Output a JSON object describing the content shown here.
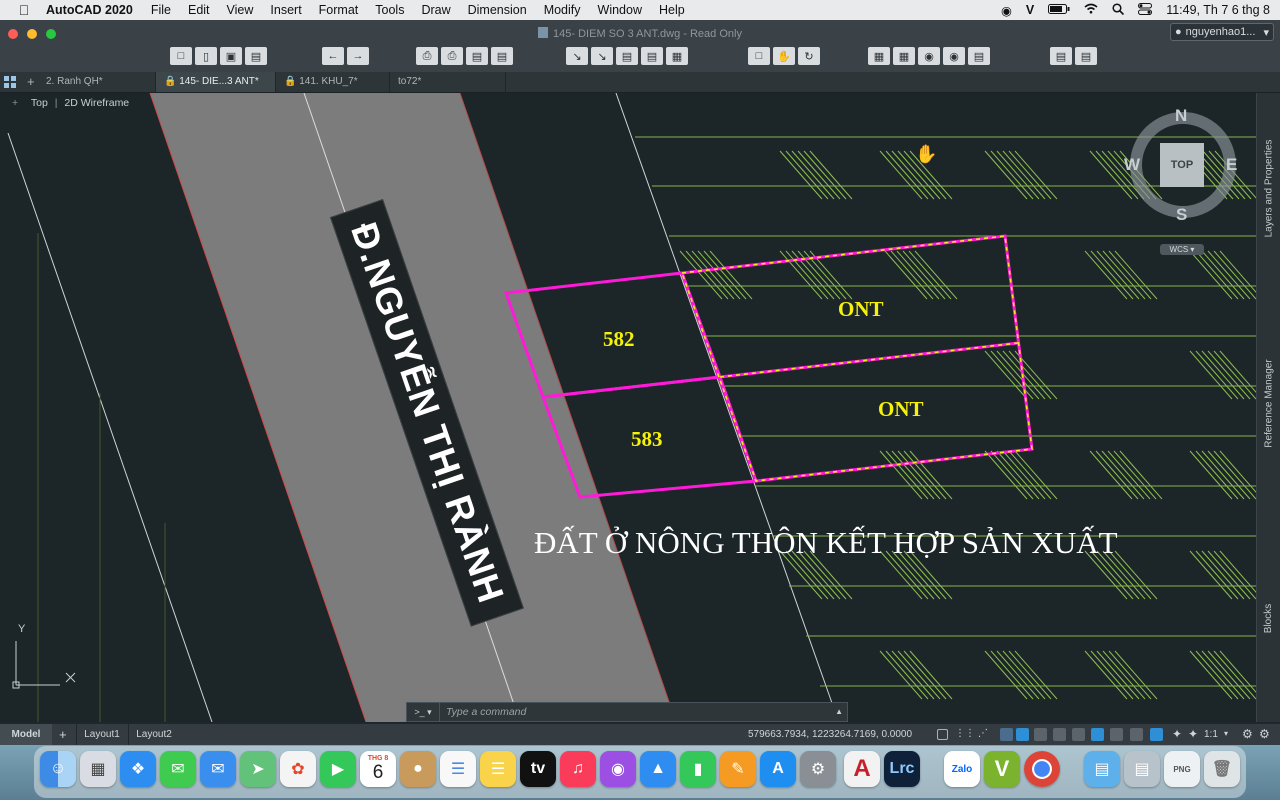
{
  "menubar": {
    "app_name": "AutoCAD 2020",
    "items": [
      "File",
      "Edit",
      "View",
      "Insert",
      "Format",
      "Tools",
      "Draw",
      "Dimension",
      "Modify",
      "Window",
      "Help"
    ],
    "clock": "11:49, Th 7 6 thg 8"
  },
  "window": {
    "title": "145- DIEM SO 3 ANT.dwg - Read Only",
    "user": "nguyenhao1..."
  },
  "tabs": [
    {
      "label": "2. Ranh QH*"
    },
    {
      "label": "145- DIE...3 ANT*"
    },
    {
      "label": "141. KHU_7*"
    },
    {
      "label": "to72*"
    }
  ],
  "viewport": {
    "view": "Top",
    "style": "2D Wireframe"
  },
  "viewcube": {
    "n": "N",
    "s": "S",
    "e": "E",
    "w": "W",
    "face": "TOP",
    "ucs": "WCS"
  },
  "ucs_icon": {
    "y": "Y"
  },
  "drawing": {
    "road_name": "Đ.NGUYỄN THỊ RÀNH",
    "parcels": [
      {
        "number": "582",
        "use": "ONT"
      },
      {
        "number": "583",
        "use": "ONT"
      }
    ],
    "zone_label": "ĐẤT Ở NÔNG THÔN KẾT HỢP SẢN XUẤT"
  },
  "right_panel": [
    "Layers and Properties",
    "Reference Manager",
    "Blocks"
  ],
  "command": {
    "placeholder": "Type a command"
  },
  "layouts": [
    "Model",
    "Layout1",
    "Layout2"
  ],
  "status": {
    "coords": "579663.7934, 1223264.7169, 0.0000",
    "scale": "1:1"
  },
  "dock": {
    "calendar_month": "THG 8",
    "calendar_day": "6",
    "zalo": "Zalo",
    "lrc": "Lrc"
  }
}
